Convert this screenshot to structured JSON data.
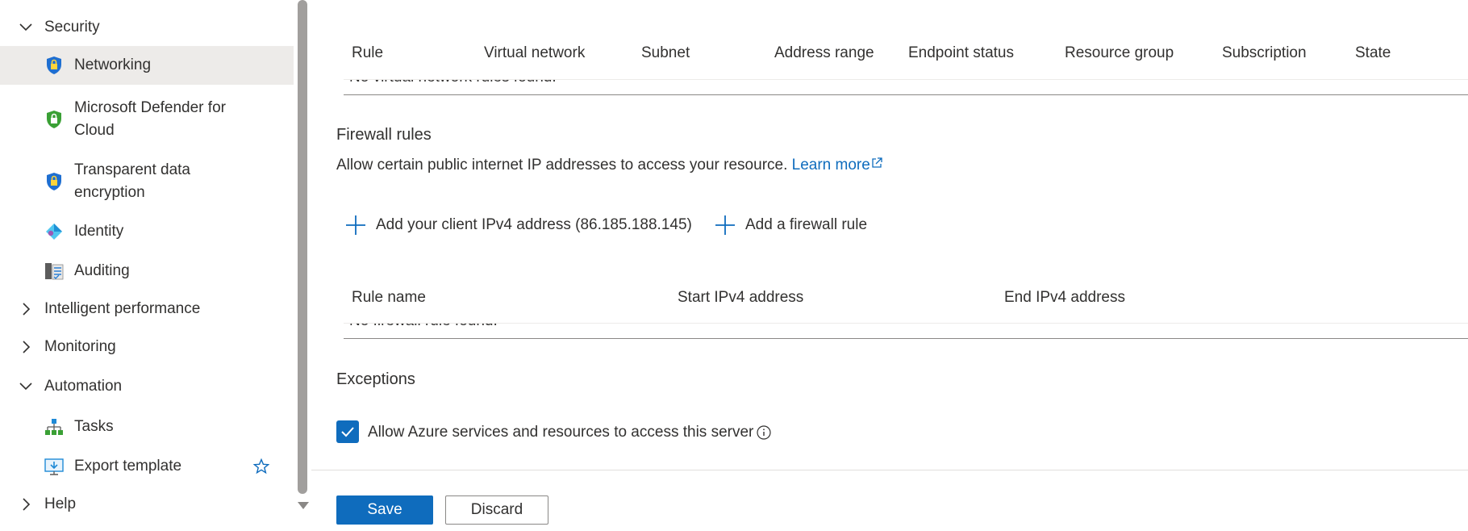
{
  "sidebar": {
    "security": {
      "label": "Security"
    },
    "items": [
      {
        "label": "Networking"
      },
      {
        "label": "Microsoft Defender for Cloud"
      },
      {
        "label": "Transparent data encryption"
      },
      {
        "label": "Identity"
      },
      {
        "label": "Auditing"
      }
    ],
    "intelligent_performance": {
      "label": "Intelligent performance"
    },
    "monitoring": {
      "label": "Monitoring"
    },
    "automation": {
      "label": "Automation",
      "items": [
        {
          "label": "Tasks"
        },
        {
          "label": "Export template"
        }
      ]
    },
    "help": {
      "label": "Help"
    }
  },
  "vnet_table": {
    "columns": [
      "Rule",
      "Virtual network",
      "Subnet",
      "Address range",
      "Endpoint status",
      "Resource group",
      "Subscription",
      "State"
    ],
    "empty_text": "No virtual network rules found."
  },
  "firewall": {
    "title": "Firewall rules",
    "description": "Allow certain public internet IP addresses to access your resource.",
    "learn_more": "Learn more",
    "add_client_ip": "Add your client IPv4 address (86.185.188.145)",
    "add_rule": "Add a firewall rule",
    "columns": [
      "Rule name",
      "Start IPv4 address",
      "End IPv4 address"
    ],
    "empty_text": "No firewall rule found."
  },
  "exceptions": {
    "title": "Exceptions",
    "allow_azure": "Allow Azure services and resources to access this server",
    "allow_azure_checked": true
  },
  "footer": {
    "save_label": "Save",
    "discard_label": "Discard"
  },
  "colors": {
    "accent": "#0f6cbd",
    "selected_bg": "#edebe9"
  }
}
